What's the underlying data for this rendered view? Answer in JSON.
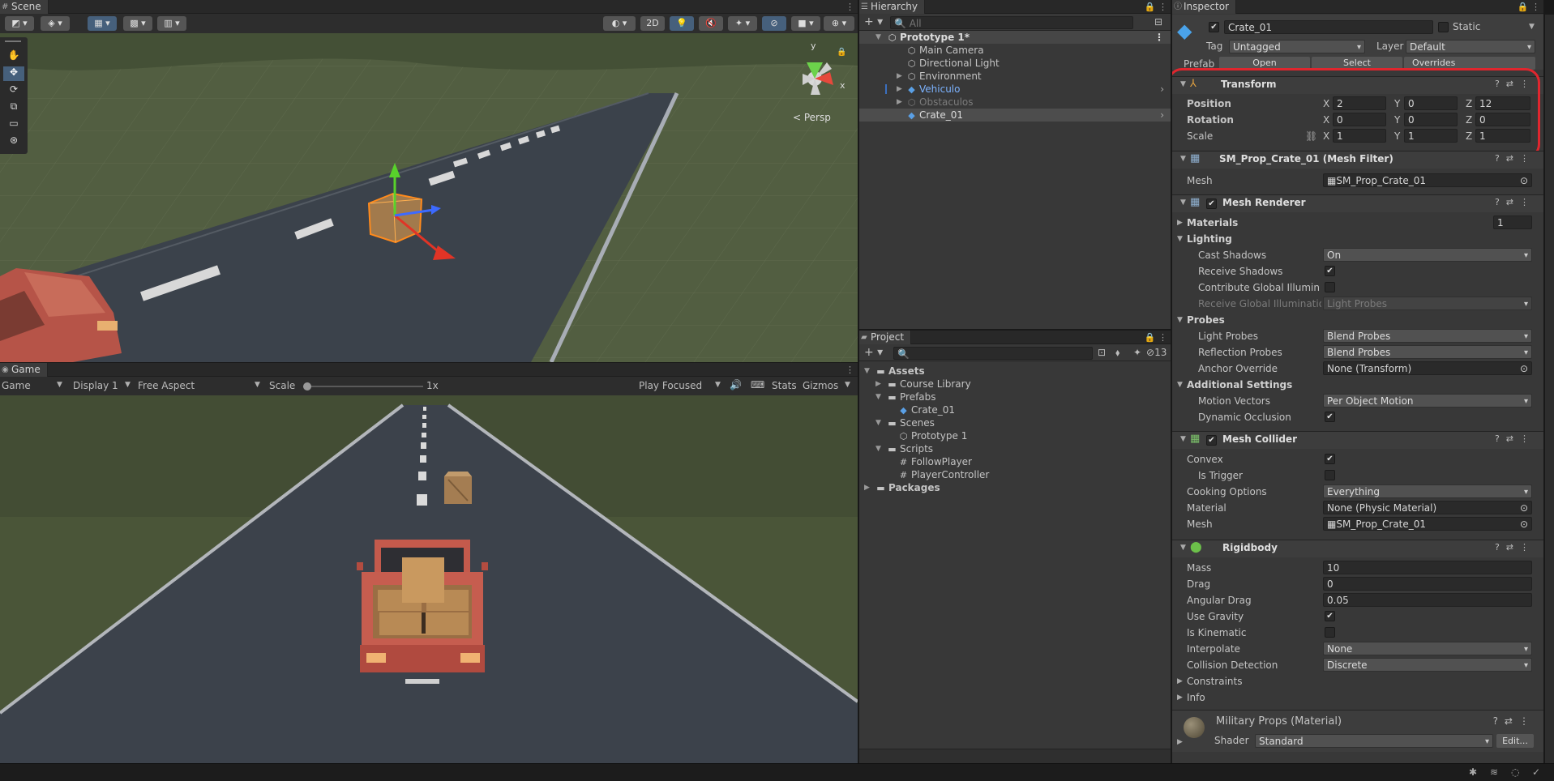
{
  "scene": {
    "tab": "Scene",
    "toolbar": {
      "btn_2d": "2D"
    },
    "persp_label": "< Persp",
    "gizmo_y": "y",
    "gizmo_x": "x",
    "tools": [
      "hand-tool",
      "move-tool",
      "rotate-tool",
      "scale-tool",
      "rect-tool",
      "transform-tool"
    ]
  },
  "game": {
    "tab": "Game",
    "display_label": "Game",
    "display": "Display 1",
    "aspect": "Free Aspect",
    "scale_label": "Scale",
    "scale_value": "1x",
    "play_mode": "Play Focused",
    "stats": "Stats",
    "gizmos": "Gizmos"
  },
  "hierarchy": {
    "tab": "Hierarchy",
    "search_placeholder": "All",
    "items": [
      {
        "label": "Prototype 1*",
        "indent": 0
      },
      {
        "label": "Main Camera",
        "indent": 1
      },
      {
        "label": "Directional Light",
        "indent": 1
      },
      {
        "label": "Environment",
        "indent": 1
      },
      {
        "label": "Vehiculo",
        "indent": 1
      },
      {
        "label": "Obstaculos",
        "indent": 1
      },
      {
        "label": "Crate_01",
        "indent": 1
      }
    ]
  },
  "project": {
    "tab": "Project",
    "hidden_count": "13",
    "items": [
      {
        "label": "Assets"
      },
      {
        "label": "Course Library"
      },
      {
        "label": "Prefabs"
      },
      {
        "label": "Crate_01"
      },
      {
        "label": "Scenes"
      },
      {
        "label": "Prototype 1"
      },
      {
        "label": "Scripts"
      },
      {
        "label": "FollowPlayer"
      },
      {
        "label": "PlayerController"
      },
      {
        "label": "Packages"
      }
    ]
  },
  "inspector": {
    "tab": "Inspector",
    "object_name": "Crate_01",
    "static_label": "Static",
    "tag_label": "Tag",
    "tag_value": "Untagged",
    "layer_label": "Layer",
    "layer_value": "Default",
    "prefab_label": "Prefab",
    "prefab_open": "Open",
    "prefab_select": "Select",
    "prefab_overrides": "Overrides",
    "transform": {
      "title": "Transform",
      "position_label": "Position",
      "rotation_label": "Rotation",
      "scale_label": "Scale",
      "position": {
        "x": "2",
        "y": "0",
        "z": "12"
      },
      "rotation": {
        "x": "0",
        "y": "0",
        "z": "0"
      },
      "scale": {
        "x": "1",
        "y": "1",
        "z": "1"
      }
    },
    "axis_labels": {
      "x": "X",
      "y": "Y",
      "z": "Z"
    },
    "mesh_filter": {
      "title": "SM_Prop_Crate_01 (Mesh Filter)",
      "mesh_label": "Mesh",
      "mesh_value": "SM_Prop_Crate_01"
    },
    "mesh_renderer": {
      "title": "Mesh Renderer",
      "materials_label": "Materials",
      "materials_count": "1",
      "lighting_label": "Lighting",
      "cast_shadows_label": "Cast Shadows",
      "cast_shadows_value": "On",
      "receive_shadows_label": "Receive Shadows",
      "contribute_gi_label": "Contribute Global Illuminatio",
      "receive_gi_label": "Receive Global Illumination",
      "receive_gi_value": "Light Probes",
      "probes_label": "Probes",
      "light_probes_label": "Light Probes",
      "light_probes_value": "Blend Probes",
      "reflection_probes_label": "Reflection Probes",
      "reflection_probes_value": "Blend Probes",
      "anchor_override_label": "Anchor Override",
      "anchor_override_value": "None (Transform)",
      "additional_label": "Additional Settings",
      "motion_vectors_label": "Motion Vectors",
      "motion_vectors_value": "Per Object Motion",
      "dynamic_occlusion_label": "Dynamic Occlusion"
    },
    "mesh_collider": {
      "title": "Mesh Collider",
      "convex_label": "Convex",
      "is_trigger_label": "Is Trigger",
      "cooking_label": "Cooking Options",
      "cooking_value": "Everything",
      "material_label": "Material",
      "material_value": "None (Physic Material)",
      "mesh_label": "Mesh",
      "mesh_value": "SM_Prop_Crate_01"
    },
    "rigidbody": {
      "title": "Rigidbody",
      "mass_label": "Mass",
      "mass_value": "10",
      "drag_label": "Drag",
      "drag_value": "0",
      "angular_drag_label": "Angular Drag",
      "angular_drag_value": "0.05",
      "use_gravity_label": "Use Gravity",
      "is_kinematic_label": "Is Kinematic",
      "interpolate_label": "Interpolate",
      "interpolate_value": "None",
      "collision_label": "Collision Detection",
      "collision_value": "Discrete",
      "constraints_label": "Constraints",
      "info_label": "Info"
    },
    "material": {
      "title": "Military Props (Material)",
      "shader_label": "Shader",
      "shader_value": "Standard",
      "edit_label": "Edit..."
    }
  },
  "colors": {
    "accent": "#3a5f8a",
    "highlight": "#e0262e",
    "selection": "#4d4d4d",
    "prefab_blue": "#7cb3ff"
  }
}
